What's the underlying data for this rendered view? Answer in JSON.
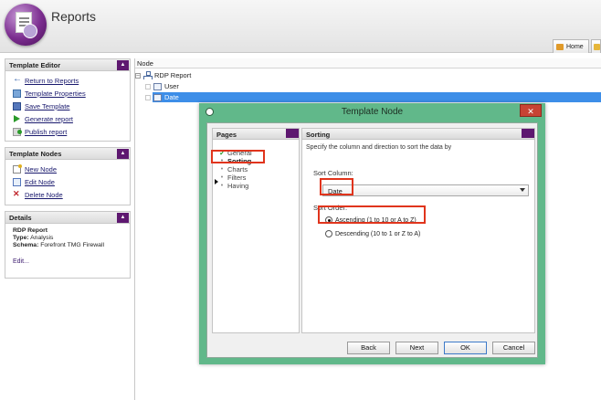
{
  "app": {
    "title": "Reports"
  },
  "tabs": {
    "home_label": "Home"
  },
  "template_editor": {
    "title": "Template Editor",
    "items": [
      {
        "label": "Return to Reports",
        "icon": "back-arrow-icon"
      },
      {
        "label": "Template Properties",
        "icon": "properties-icon"
      },
      {
        "label": "Save Template",
        "icon": "save-icon"
      },
      {
        "label": "Generate report",
        "icon": "play-icon"
      },
      {
        "label": "Publish report",
        "icon": "publish-icon"
      }
    ]
  },
  "template_nodes": {
    "title": "Template Nodes",
    "items": [
      {
        "label": "New Node",
        "icon": "new-node-icon"
      },
      {
        "label": "Edit Node",
        "icon": "edit-node-icon"
      },
      {
        "label": "Delete Node",
        "icon": "delete-icon"
      }
    ]
  },
  "details": {
    "title": "Details",
    "report_name": "RDP Report",
    "type_label": "Type:",
    "type_value": "Analysis",
    "schema_label": "Schema:",
    "schema_value": "Forefront TMG Firewall",
    "edit_link": "Edit..."
  },
  "tree": {
    "header": "Node",
    "root": "RDP Report",
    "children": [
      "User",
      "Date"
    ],
    "selected": "Date"
  },
  "dialog": {
    "title": "Template Node",
    "pages_title": "Pages",
    "pages": [
      {
        "label": "General",
        "state": "done"
      },
      {
        "label": "Sorting",
        "state": "active"
      },
      {
        "label": "Charts",
        "state": "pending"
      },
      {
        "label": "Filters",
        "state": "pending"
      },
      {
        "label": "Having",
        "state": "pending"
      }
    ],
    "sorting": {
      "title": "Sorting",
      "description": "Specify the column and direction to sort the data by",
      "column_label": "Sort Column:",
      "column_value": "Date",
      "order_label": "Sort Order:",
      "ascending_label": "Ascending (1 to 10 or A to Z)",
      "descending_label": "Descending (10 to 1 or Z to A)",
      "selected_order": "ascending"
    },
    "buttons": {
      "back": "Back",
      "next": "Next",
      "ok": "OK",
      "cancel": "Cancel"
    }
  },
  "colors": {
    "accent_purple": "#5e1870",
    "dialog_frame": "#61b88a",
    "selection_blue": "#3d8ee8",
    "highlight_red": "#e0341c",
    "close_red": "#c84334"
  }
}
